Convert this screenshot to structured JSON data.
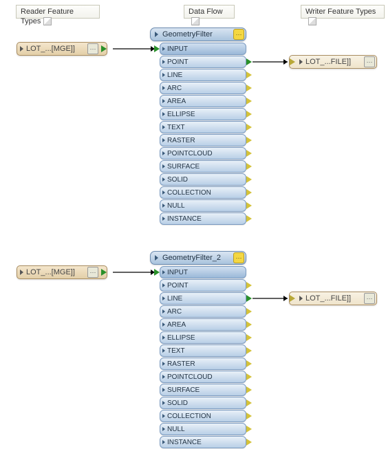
{
  "headers": {
    "reader": "Reader Feature Types",
    "dataflow": "Data Flow",
    "writer": "Writer Feature Types"
  },
  "readers": [
    {
      "label": "LOT_...[MGE]]"
    },
    {
      "label": "LOT_...[MGE]]"
    }
  ],
  "writers": [
    {
      "label": "LOT_...FILE]]"
    },
    {
      "label": "LOT_...FILE]]"
    }
  ],
  "transformers": [
    {
      "name": "GeometryFilter",
      "ports": [
        "POINT",
        "LINE",
        "ARC",
        "AREA",
        "ELLIPSE",
        "TEXT",
        "RASTER",
        "POINTCLOUD",
        "SURFACE",
        "SOLID",
        "COLLECTION",
        "NULL",
        "INSTANCE"
      ],
      "input_label": "INPUT",
      "connected_port_index": 0
    },
    {
      "name": "GeometryFilter_2",
      "ports": [
        "POINT",
        "LINE",
        "ARC",
        "AREA",
        "ELLIPSE",
        "TEXT",
        "RASTER",
        "POINTCLOUD",
        "SURFACE",
        "SOLID",
        "COLLECTION",
        "NULL",
        "INSTANCE"
      ],
      "input_label": "INPUT",
      "connected_port_index": 1
    }
  ],
  "chart_data": {
    "type": "diagram",
    "description": "FME workspace canvas with two reader feature types, two GeometryFilter transformers, and two writer feature types.",
    "connections": [
      {
        "from": "Reader[0].out",
        "to": "GeometryFilter.INPUT"
      },
      {
        "from": "GeometryFilter.POINT",
        "to": "Writer[0].in"
      },
      {
        "from": "Reader[1].out",
        "to": "GeometryFilter_2.INPUT"
      },
      {
        "from": "GeometryFilter_2.LINE",
        "to": "Writer[1].in"
      }
    ]
  }
}
